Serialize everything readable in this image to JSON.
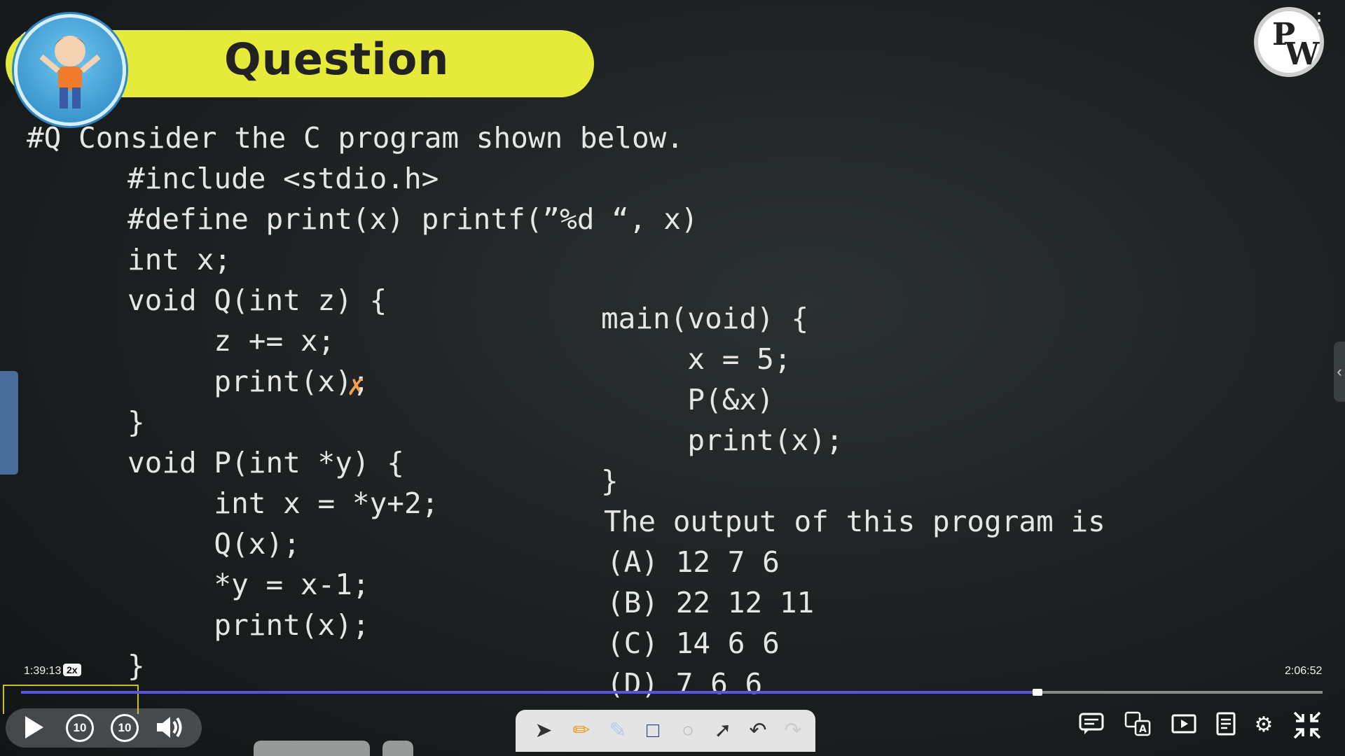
{
  "header": {
    "title": "Question",
    "logo_text_top": "P",
    "logo_text_bottom": "W"
  },
  "question": {
    "prompt": "#Q Consider the C program shown below.",
    "left_code": [
      "#include <stdio.h>",
      "#define print(x) printf(”%d “, x)",
      "int x;",
      "void Q(int z) {",
      "     z += x;",
      "     print(x);",
      "}",
      "void P(int *y) {",
      "     int x = *y+2;",
      "     Q(x);",
      "     *y = x-1;",
      "     print(x);",
      "}"
    ],
    "right_code": [
      "main(void) {",
      "     x = 5;",
      "     P(&x)",
      "     print(x);",
      "}"
    ],
    "output_prompt": "The output of this program is",
    "options": [
      "(A) 12 7 6",
      "(B) 22 12 11",
      "(C) 14 6 6",
      "(D) 7 6 6"
    ]
  },
  "player": {
    "current_time": "1:39:13",
    "speed": "2x",
    "total_time": "2:06:52",
    "progress_fraction": 0.781,
    "rewind_label": "10",
    "forward_label": "10"
  },
  "icons": {
    "back": "arrow-left-icon",
    "play": "play-icon",
    "volume": "volume-icon",
    "chat": "chat-icon",
    "translate": "translate-icon",
    "pip": "picture-in-picture-icon",
    "notes": "notes-icon",
    "settings": "gear-icon",
    "exit_fullscreen": "exit-fullscreen-icon"
  },
  "colors": {
    "banner": "#e6ea3a",
    "progress": "#5a52e0",
    "highlight": "#f5a04a"
  }
}
